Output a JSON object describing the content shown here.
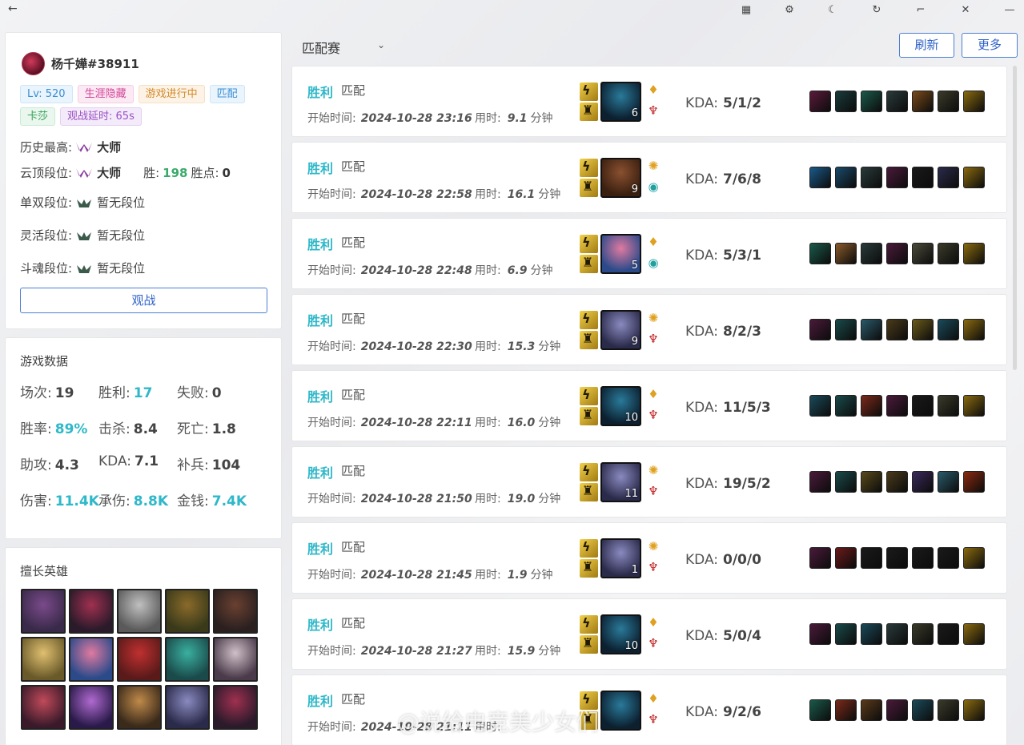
{
  "titlebar": {
    "back": "←",
    "buttons": [
      {
        "name": "grid-icon",
        "glyph": "▦"
      },
      {
        "name": "settings-icon",
        "glyph": "⚙"
      },
      {
        "name": "theme-moon-icon",
        "glyph": "☾"
      },
      {
        "name": "refresh-icon",
        "glyph": "↻"
      },
      {
        "name": "minimize-icon",
        "glyph": "⌐"
      },
      {
        "name": "close-icon",
        "glyph": "✕"
      },
      {
        "name": "window-min-icon",
        "glyph": "—"
      }
    ]
  },
  "profile": {
    "name": "杨千嬅#38911",
    "tags": [
      {
        "text": "Lv: 520",
        "color": "#3b8ed4",
        "bg": "#e9f4fc",
        "border": "#cfe6f8"
      },
      {
        "text": "生涯隐藏",
        "color": "#d4479a",
        "bg": "#fbe9f3",
        "border": "#f5cde4"
      },
      {
        "text": "游戏进行中",
        "color": "#d48a2a",
        "bg": "#fcf3e6",
        "border": "#f6e1c2"
      },
      {
        "text": "匹配",
        "color": "#3b8ed4",
        "bg": "#e9f4fc",
        "border": "#cfe6f8"
      },
      {
        "text": "卡莎",
        "color": "#36a35a",
        "bg": "#eaf7ee",
        "border": "#cbead5"
      },
      {
        "text": "观战延时: 65s",
        "color": "#9a4fc4",
        "bg": "#f4ebfa",
        "border": "#e3d0f1"
      }
    ],
    "history_label": "历史最高:",
    "history_value": "大师",
    "tft_label": "云顶段位:",
    "tft_value": "大师",
    "tft_win_label": "胜:",
    "tft_win_value": "198",
    "tft_lp_label": "胜点:",
    "tft_lp_value": "0",
    "solo_label": "单双段位:",
    "solo_value": "暂无段位",
    "flex_label": "灵活段位:",
    "flex_value": "暂无段位",
    "arena_label": "斗魂段位:",
    "arena_value": "暂无段位",
    "spectate_label": "观战"
  },
  "stats": {
    "title": "游戏数据",
    "rows": [
      [
        {
          "label": "场次:",
          "value": "19",
          "hl": false
        },
        {
          "label": "胜利:",
          "value": "17",
          "hl": true
        },
        {
          "label": "失败:",
          "value": "0",
          "hl": false
        }
      ],
      [
        {
          "label": "胜率:",
          "value": "89%",
          "hl": true
        },
        {
          "label": "击杀:",
          "value": "8.4",
          "hl": false
        },
        {
          "label": "死亡:",
          "value": "1.8",
          "hl": false
        }
      ],
      [
        {
          "label": "助攻:",
          "value": "4.3",
          "hl": false
        },
        {
          "label": "KDA:",
          "value": "7.1",
          "hl": false
        },
        {
          "label": "补兵:",
          "value": "104",
          "hl": false
        }
      ],
      [
        {
          "label": "伤害:",
          "value": "11.4K",
          "hl": true
        },
        {
          "label": "承伤:",
          "value": "8.8K",
          "hl": true
        },
        {
          "label": "金钱:",
          "value": "7.4K",
          "hl": true
        }
      ]
    ]
  },
  "champions": {
    "title": "擅长英雄",
    "list": [
      {
        "name": "champion-1",
        "colors": [
          "#3a2a4a",
          "#7a4a8a"
        ]
      },
      {
        "name": "champion-2",
        "colors": [
          "#2a1a2a",
          "#a03050"
        ]
      },
      {
        "name": "champion-3",
        "colors": [
          "#5a5a5a",
          "#c0c0c0"
        ]
      },
      {
        "name": "champion-4",
        "colors": [
          "#3a3a1a",
          "#8a6a2a"
        ]
      },
      {
        "name": "champion-5",
        "colors": [
          "#2a2020",
          "#6a4030"
        ]
      },
      {
        "name": "champion-6",
        "colors": [
          "#6a5a2a",
          "#e0c070"
        ]
      },
      {
        "name": "champion-7",
        "colors": [
          "#2a4a8a",
          "#e07aa0"
        ]
      },
      {
        "name": "champion-8",
        "colors": [
          "#5a1a1a",
          "#c03030"
        ]
      },
      {
        "name": "champion-9",
        "colors": [
          "#1a4a4a",
          "#3ab0a0"
        ]
      },
      {
        "name": "champion-10",
        "colors": [
          "#4a3a4a",
          "#d0c0c8"
        ]
      },
      {
        "name": "champion-11",
        "colors": [
          "#3a1a2a",
          "#c04a5a"
        ]
      },
      {
        "name": "champion-12",
        "colors": [
          "#2a1a4a",
          "#b06ad0"
        ]
      },
      {
        "name": "champion-13",
        "colors": [
          "#3a2a1a",
          "#c08a4a"
        ]
      },
      {
        "name": "champion-14",
        "colors": [
          "#2a2a4a",
          "#8a8ac0"
        ]
      },
      {
        "name": "champion-15",
        "colors": [
          "#2a1a2a",
          "#a03050"
        ]
      }
    ]
  },
  "header": {
    "mode": "匹配赛",
    "refresh_label": "刷新",
    "more_label": "更多"
  },
  "matches": [
    {
      "result": "胜利",
      "mode": "匹配",
      "time_label": "开始时间:",
      "time": "2024-10-28 23:16",
      "dur_label": "用时:",
      "dur": "9.1",
      "dur_unit": "分钟",
      "level": "6",
      "kda_label": "KDA:",
      "kda": "5/1/2",
      "champ": [
        "#0c2030",
        "#2a7a9a"
      ],
      "rune1": "♦",
      "rune1c": "#e0a020",
      "rune2": "♆",
      "rune2c": "#c02020",
      "items": [
        "#5a1a3a",
        "#1a3a3a",
        "#1a5a4a",
        "#2a3a3a",
        "#7a4a1a",
        "#3a3a2a",
        "#8a6a10"
      ]
    },
    {
      "result": "胜利",
      "mode": "匹配",
      "time_label": "开始时间:",
      "time": "2024-10-28 22:58",
      "dur_label": "用时:",
      "dur": "16.1",
      "dur_unit": "分钟",
      "level": "9",
      "kda_label": "KDA:",
      "kda": "7/6/8",
      "champ": [
        "#3a2010",
        "#8a5030"
      ],
      "rune1": "✺",
      "rune1c": "#e0a020",
      "rune2": "◉",
      "rune2c": "#20a0a0",
      "items": [
        "#1a5a8a",
        "#1a4a6a",
        "#2a3a3a",
        "#4a1a3a",
        "#1a1a1a",
        "#2a2a4a",
        "#8a6a10"
      ]
    },
    {
      "result": "胜利",
      "mode": "匹配",
      "time_label": "开始时间:",
      "time": "2024-10-28 22:48",
      "dur_label": "用时:",
      "dur": "6.9",
      "dur_unit": "分钟",
      "level": "5",
      "kda_label": "KDA:",
      "kda": "5/3/1",
      "champ": [
        "#2a4a8a",
        "#e07aa0"
      ],
      "rune1": "♦",
      "rune1c": "#e0a020",
      "rune2": "◉",
      "rune2c": "#20a0a0",
      "items": [
        "#1a5a4a",
        "#8a5a2a",
        "#2a3a3a",
        "#4a1a3a",
        "#4a4a3a",
        "#3a3a2a",
        "#8a6a10"
      ]
    },
    {
      "result": "胜利",
      "mode": "匹配",
      "time_label": "开始时间:",
      "time": "2024-10-28 22:30",
      "dur_label": "用时:",
      "dur": "15.3",
      "dur_unit": "分钟",
      "level": "9",
      "kda_label": "KDA:",
      "kda": "8/2/3",
      "champ": [
        "#2a2a4a",
        "#8a8ac0"
      ],
      "rune1": "✺",
      "rune1c": "#e0a020",
      "rune2": "♆",
      "rune2c": "#c02020",
      "items": [
        "#4a1a3a",
        "#1a4a4a",
        "#2a5a6a",
        "#4a3a1a",
        "#6a5a1a",
        "#1a4a5a",
        "#8a6a10"
      ]
    },
    {
      "result": "胜利",
      "mode": "匹配",
      "time_label": "开始时间:",
      "time": "2024-10-28 22:11",
      "dur_label": "用时:",
      "dur": "16.0",
      "dur_unit": "分钟",
      "level": "10",
      "kda_label": "KDA:",
      "kda": "11/5/3",
      "champ": [
        "#0c2030",
        "#2a7a9a"
      ],
      "rune1": "♦",
      "rune1c": "#e0a020",
      "rune2": "♆",
      "rune2c": "#c02020",
      "items": [
        "#1a4a5a",
        "#1a4a4a",
        "#7a2a1a",
        "#4a1a3a",
        "#1a1a1a",
        "#3a3a2a",
        "#8a6a10"
      ]
    },
    {
      "result": "胜利",
      "mode": "匹配",
      "time_label": "开始时间:",
      "time": "2024-10-28 21:50",
      "dur_label": "用时:",
      "dur": "19.0",
      "dur_unit": "分钟",
      "level": "11",
      "kda_label": "KDA:",
      "kda": "19/5/2",
      "champ": [
        "#2a2a4a",
        "#8a8ac0"
      ],
      "rune1": "✺",
      "rune1c": "#e0a020",
      "rune2": "♆",
      "rune2c": "#c02020",
      "items": [
        "#4a1a3a",
        "#1a4a4a",
        "#5a4a1a",
        "#4a3a1a",
        "#3a2a5a",
        "#2a5a6a",
        "#8a2a10"
      ]
    },
    {
      "result": "胜利",
      "mode": "匹配",
      "time_label": "开始时间:",
      "time": "2024-10-28 21:45",
      "dur_label": "用时:",
      "dur": "1.9",
      "dur_unit": "分钟",
      "level": "1",
      "kda_label": "KDA:",
      "kda": "0/0/0",
      "champ": [
        "#2a2a4a",
        "#8a8ac0"
      ],
      "rune1": "✺",
      "rune1c": "#e0a020",
      "rune2": "♆",
      "rune2c": "#c02020",
      "items": [
        "#4a1a3a",
        "#6a1a1a",
        "#1a1a1a",
        "#1a1a1a",
        "#1a1a1a",
        "#1a1a1a",
        "#8a6a10"
      ]
    },
    {
      "result": "胜利",
      "mode": "匹配",
      "time_label": "开始时间:",
      "time": "2024-10-28 21:27",
      "dur_label": "用时:",
      "dur": "15.9",
      "dur_unit": "分钟",
      "level": "10",
      "kda_label": "KDA:",
      "kda": "5/0/4",
      "champ": [
        "#0c2030",
        "#2a7a9a"
      ],
      "rune1": "♦",
      "rune1c": "#e0a020",
      "rune2": "♆",
      "rune2c": "#c02020",
      "items": [
        "#4a1a3a",
        "#1a4a4a",
        "#1a4a5a",
        "#2a3a3a",
        "#3a3a2a",
        "#1a1a1a",
        "#8a6a10"
      ]
    },
    {
      "result": "胜利",
      "mode": "匹配",
      "time_label": "开始时间:",
      "time": "2024-10-28 21:11",
      "dur_label": "用时:",
      "dur": "",
      "dur_unit": "",
      "level": "",
      "kda_label": "KDA:",
      "kda": "9/2/6",
      "champ": [
        "#0c2030",
        "#2a7a9a"
      ],
      "rune1": "♦",
      "rune1c": "#e0a020",
      "rune2": "♆",
      "rune2c": "#c02020",
      "items": [
        "#1a5a4a",
        "#7a2a1a",
        "#5a3a1a",
        "#4a1a3a",
        "#1a4a5a",
        "#3a3a2a",
        "#8a6a10"
      ]
    }
  ],
  "watermark": "@说给电竞美少女们"
}
